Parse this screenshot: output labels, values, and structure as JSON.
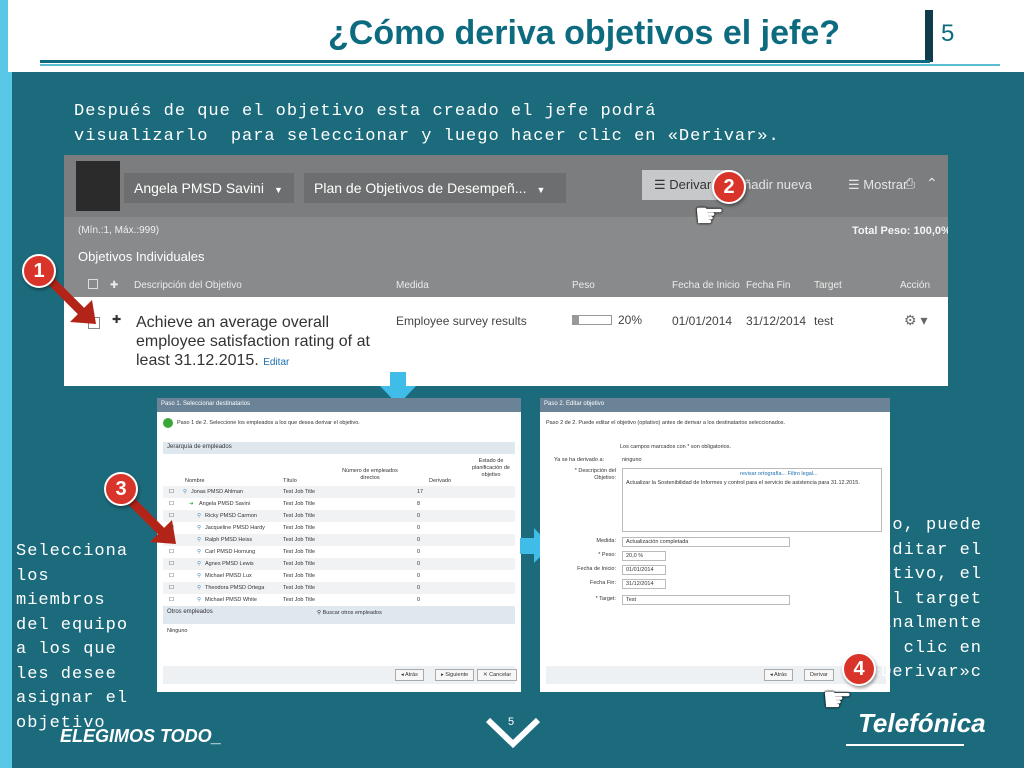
{
  "slide": {
    "title": "¿Cómo deriva objetivos el jefe?",
    "page_number": "5",
    "intro_text": "Después de que el objetivo esta creado el jefe podrá visualizarlo  para seleccionar y luego hacer clic en «Derivar».",
    "side_left_text": "Selecciona los miembros del equipo a los que les desee asignar el objetivo",
    "side_right_text": "Luego, puede editar el objetivo, el peso y el target para finalmente hacer clic en «Derivar»c",
    "badges": [
      "1",
      "2",
      "3",
      "4"
    ],
    "footer_brand": "ELEGIMOS TODO_",
    "footer_page": "5",
    "footer_logo": "Telefónica",
    "colors": {
      "background": "#1c6b7c",
      "accent": "#59c7e6",
      "title": "#0d6b80",
      "badge": "#d8342a"
    },
    "icons": [
      "arrow-down-icon",
      "arrow-right-icon",
      "arrow-pointer-icon",
      "hand-cursor-icon",
      "chevron-down-icon"
    ]
  },
  "screenshot1": {
    "user": "Angela PMSD Savini",
    "plan": "Plan de Objetivos de Desempeñ...",
    "derivar": "Derivar",
    "anadir": "ñadir nueva",
    "mostrar": "Mostrar",
    "min_max": "(Mín.:1, Máx.:999)",
    "total_peso": "Total Peso: 100,0%",
    "section": "Objetivos Individuales",
    "columns": [
      "Descripción del Objetivo",
      "Medida",
      "Peso",
      "Fecha de Inicio",
      "Fecha Fin",
      "Target",
      "Acción"
    ],
    "row": {
      "description": "Achieve an average overall employee satisfaction rating of at least 31.12.2015.",
      "edit": "Editar",
      "measure": "Employee survey results",
      "weight": "20%",
      "weight_fraction": 0.2,
      "start": "01/01/2014",
      "end": "31/12/2014",
      "target": "test"
    }
  },
  "panel1": {
    "title": "Paso 1. Seleccionar destinatarios",
    "step": "Paso 1 de 2. Seleccione los empleados a los que desea derivar el objetivo.",
    "hierarchy": "Jerarquía de empleados",
    "columns": [
      "Nombre",
      "Título",
      "Número de empleados directos",
      "Derivado",
      "Estado de planificación de objetivo"
    ],
    "employees": [
      {
        "name": "Jonas PMSD Ahlman",
        "title": "Test Job Title",
        "count": "17"
      },
      {
        "name": "Angela PMSD Savini",
        "title": "Test Job Title",
        "count": "8"
      },
      {
        "name": "Ricky PMSD Carmon",
        "title": "Test Job Title",
        "count": "0"
      },
      {
        "name": "Jacqueline PMSD Hardy",
        "title": "Test Job Title",
        "count": "0"
      },
      {
        "name": "Ralph PMSD Heiss",
        "title": "Test Job Title",
        "count": "0"
      },
      {
        "name": "Carl PMSD Hornung",
        "title": "Test Job Title",
        "count": "0"
      },
      {
        "name": "Agnes PMSD Lewis",
        "title": "Test Job Title",
        "count": "0"
      },
      {
        "name": "Michael PMSD Lux",
        "title": "Test Job Title",
        "count": "0"
      },
      {
        "name": "Theodora PMSD Ortega",
        "title": "Test Job Title",
        "count": "0"
      },
      {
        "name": "Michael PMSD White",
        "title": "Test Job Title",
        "count": "0"
      }
    ],
    "otros": "Otros empleados",
    "buscar": "Buscar otros empleados",
    "ninguno": "Ninguno",
    "buttons": [
      "Atrás",
      "Siguiente",
      "Cancelar"
    ]
  },
  "panel2": {
    "title": "Paso 2. Editar objetivo",
    "step": "Paso 2 de 2. Puede editar el objetivo (optativo) antes de derivar a los destinatarios seleccionados.",
    "campos": "Los campos marcados con * son obligatorios.",
    "ya_label": "Ya se ha derivado a:",
    "ya_value": "ninguno",
    "desc_label": "* Descripción del Objetivo:",
    "spell": "revisar ortografía... Filtro legal...",
    "desc_value": "Actualizar la Sostenibilidad de Informes y control para el servicio de asistencia para 31.12.2015.",
    "fields": [
      {
        "label": "Medida:",
        "value": "Actualización completada"
      },
      {
        "label": "* Peso:",
        "value": "20,0  %"
      },
      {
        "label": "Fecha de Inicio:",
        "value": "01/01/2014"
      },
      {
        "label": "Fecha Fin:",
        "value": "31/12/2014"
      },
      {
        "label": "* Target:",
        "value": "Test"
      }
    ],
    "buttons": [
      "Atrás",
      "Derivar"
    ]
  }
}
